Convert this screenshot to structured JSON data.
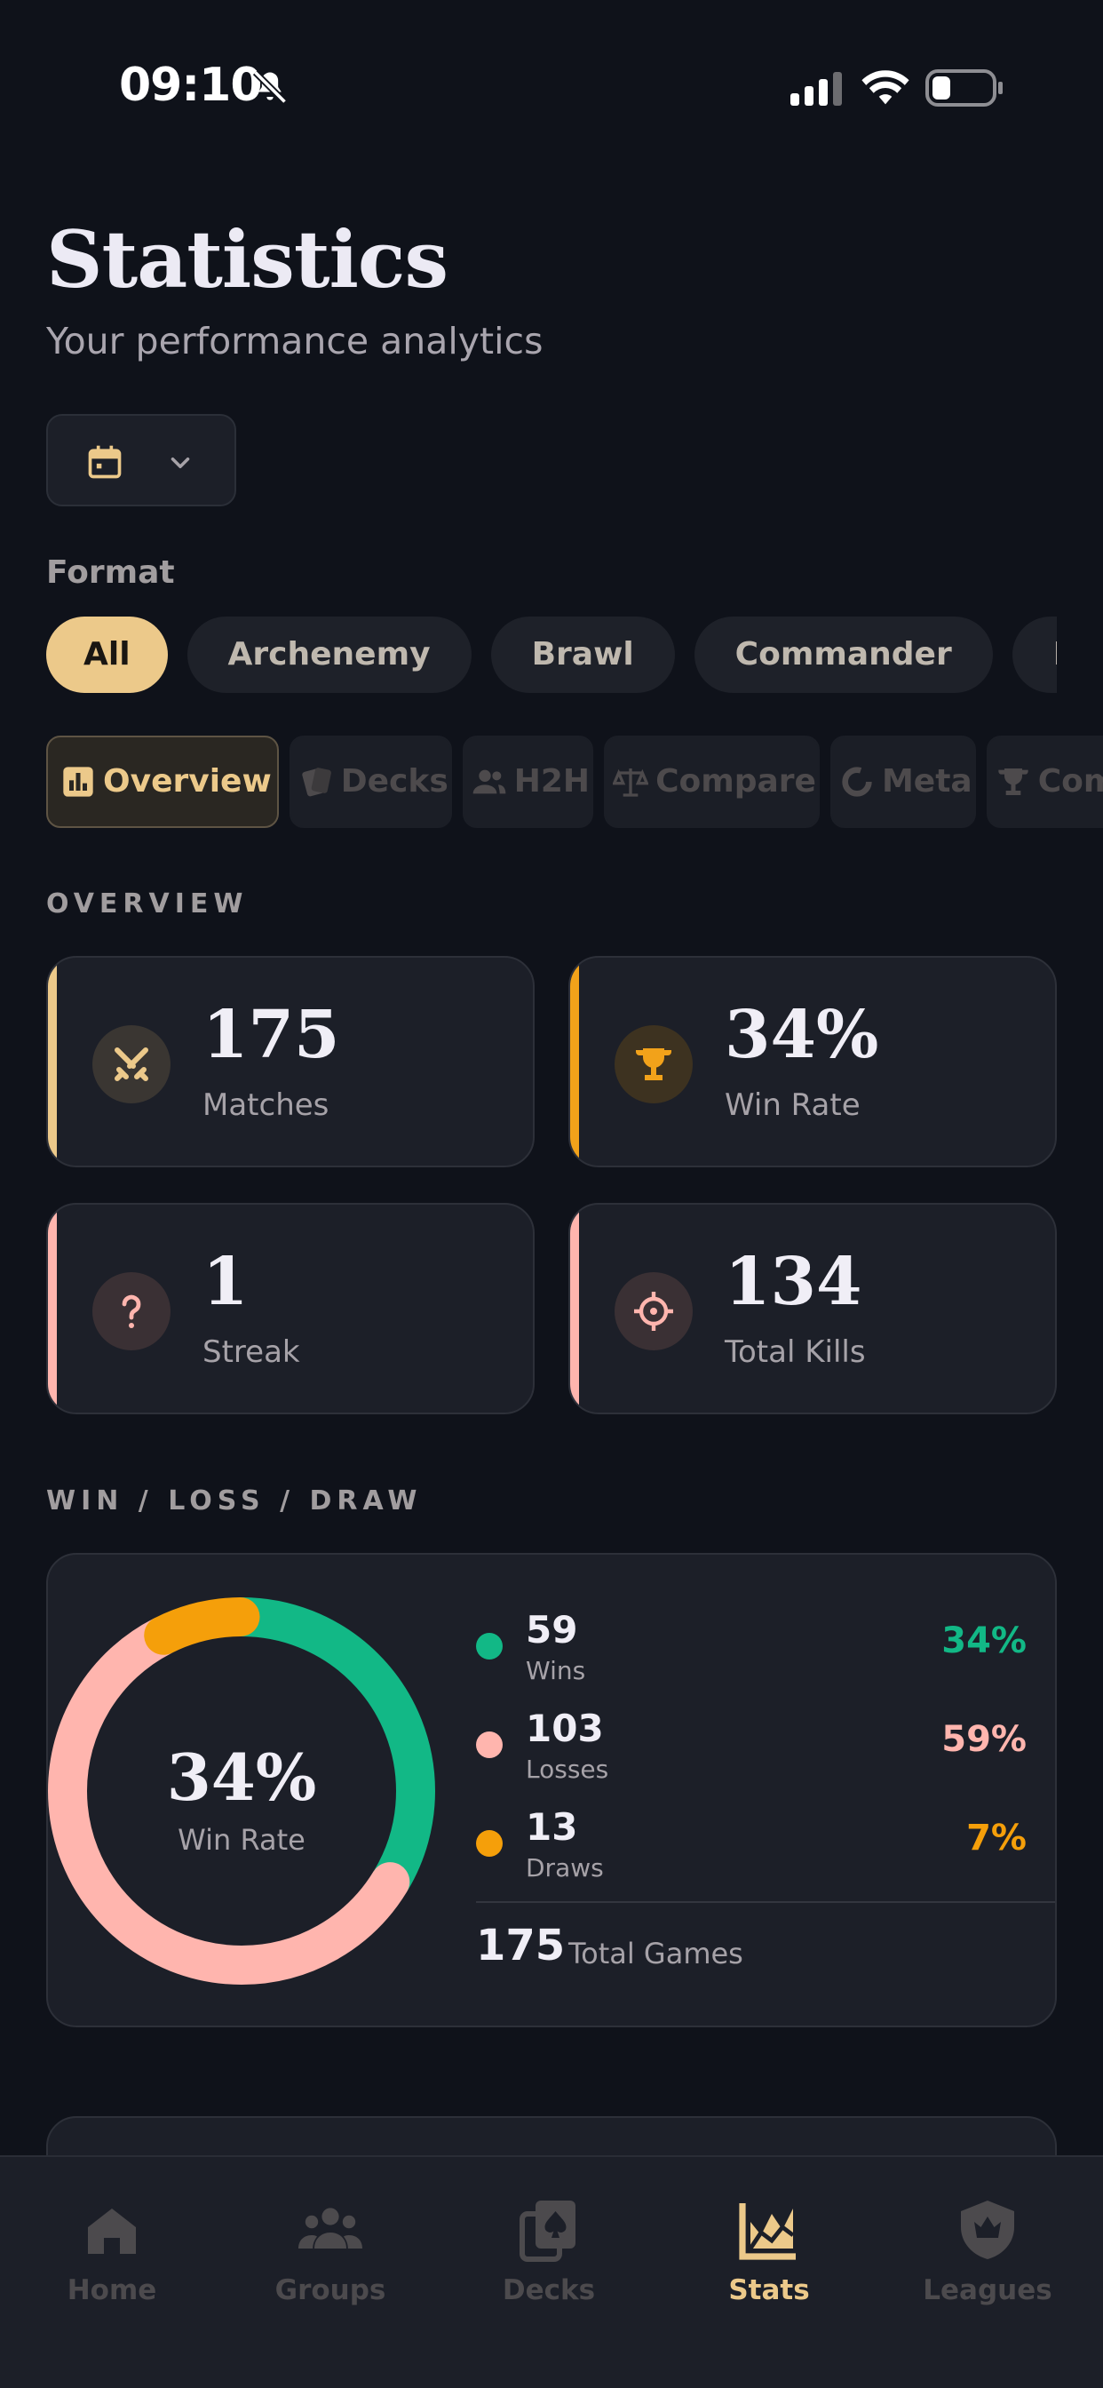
{
  "status_bar": {
    "time": "09:10"
  },
  "header": {
    "title": "Statistics",
    "subtitle": "Your performance analytics"
  },
  "format": {
    "label": "Format",
    "chips": [
      "All",
      "Archenemy",
      "Brawl",
      "Commander",
      "Draft"
    ],
    "selected": "All"
  },
  "tabs": [
    "Overview",
    "Decks",
    "H2H",
    "Compare",
    "Meta",
    "Competitive"
  ],
  "overview": {
    "label": "OVERVIEW",
    "cards": [
      {
        "value": "175",
        "label": "Matches",
        "accent": "#ecc98a",
        "icon": "crossed-swords-icon"
      },
      {
        "value": "34%",
        "label": "Win Rate",
        "accent": "#f2a21a",
        "icon": "trophy-icon"
      },
      {
        "value": "1",
        "label": "Streak",
        "accent": "#ffb5ae",
        "icon": "question-mark-icon"
      },
      {
        "value": "134",
        "label": "Total Kills",
        "accent": "#ffb5ae",
        "icon": "crosshair-icon"
      }
    ]
  },
  "wld": {
    "label": "WIN / LOSS / DRAW",
    "center_value": "34%",
    "center_label": "Win Rate",
    "items": [
      {
        "count": "59",
        "label": "Wins",
        "pct": "34%",
        "color": "#12b886"
      },
      {
        "count": "103",
        "label": "Losses",
        "pct": "59%",
        "color": "#ffb5ae"
      },
      {
        "count": "13",
        "label": "Draws",
        "pct": "7%",
        "color": "#f59f0a"
      }
    ],
    "total": "175",
    "total_label": "Total Games"
  },
  "chart_data": {
    "type": "pie",
    "categories": [
      "Wins",
      "Losses",
      "Draws"
    ],
    "values": [
      59,
      103,
      13
    ],
    "colors": [
      "#12b886",
      "#ffb5ae",
      "#f59f0a"
    ]
  },
  "nav": {
    "items": [
      "Home",
      "Groups",
      "Decks",
      "Stats",
      "Leagues"
    ],
    "active": "Stats"
  }
}
